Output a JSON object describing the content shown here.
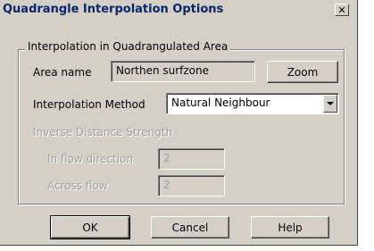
{
  "window": {
    "title": "Quadrangle Interpolation Options",
    "close_glyph": "✕"
  },
  "group": {
    "title": "Interpolation in Quadrangulated Area"
  },
  "area": {
    "label": "Area name",
    "value": "Northen surfzone"
  },
  "zoom_button": {
    "label": "Zoom"
  },
  "interpolation": {
    "label": "Interpolation Method",
    "selected": "Natural Neighbour"
  },
  "idw": {
    "title": "Inverse Distance Strength",
    "flow_label": "In flow direction",
    "flow_value": "2",
    "across_label": "Across flow",
    "across_value": "2"
  },
  "buttons": {
    "ok": "OK",
    "cancel": "Cancel",
    "help": "Help"
  }
}
